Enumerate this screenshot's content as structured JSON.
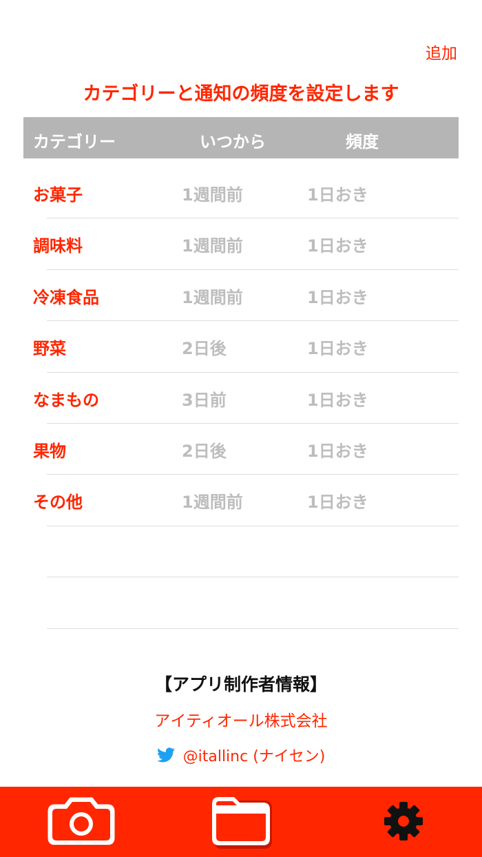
{
  "header": {
    "add_label": "追加",
    "title": "カテゴリーと通知の頻度を設定します"
  },
  "table": {
    "columns": {
      "category": "カテゴリー",
      "from": "いつから",
      "frequency": "頻度"
    },
    "rows": [
      {
        "category": "お菓子",
        "from": "1週間前",
        "frequency": "1日おき"
      },
      {
        "category": "調味料",
        "from": "1週間前",
        "frequency": "1日おき"
      },
      {
        "category": "冷凍食品",
        "from": "1週間前",
        "frequency": "1日おき"
      },
      {
        "category": "野菜",
        "from": "2日後",
        "frequency": "1日おき"
      },
      {
        "category": "なまもの",
        "from": "3日前",
        "frequency": "1日おき"
      },
      {
        "category": "果物",
        "from": "2日後",
        "frequency": "1日おき"
      },
      {
        "category": "その他",
        "from": "1週間前",
        "frequency": "1日おき"
      },
      {
        "category": "",
        "from": "",
        "frequency": ""
      },
      {
        "category": "",
        "from": "",
        "frequency": ""
      }
    ]
  },
  "credits": {
    "title": "【アプリ制作者情報】",
    "company": "アイティオール株式会社",
    "twitter_handle": "@itallinc (ナイセン)"
  },
  "tabbar": {
    "items": [
      {
        "icon": "camera-icon"
      },
      {
        "icon": "folder-icon"
      },
      {
        "icon": "gear-icon"
      }
    ]
  },
  "colors": {
    "accent": "#ff2600",
    "header_gray": "#b5b5b5",
    "muted_text": "#bdbdbd",
    "twitter_blue": "#1da1f2"
  }
}
